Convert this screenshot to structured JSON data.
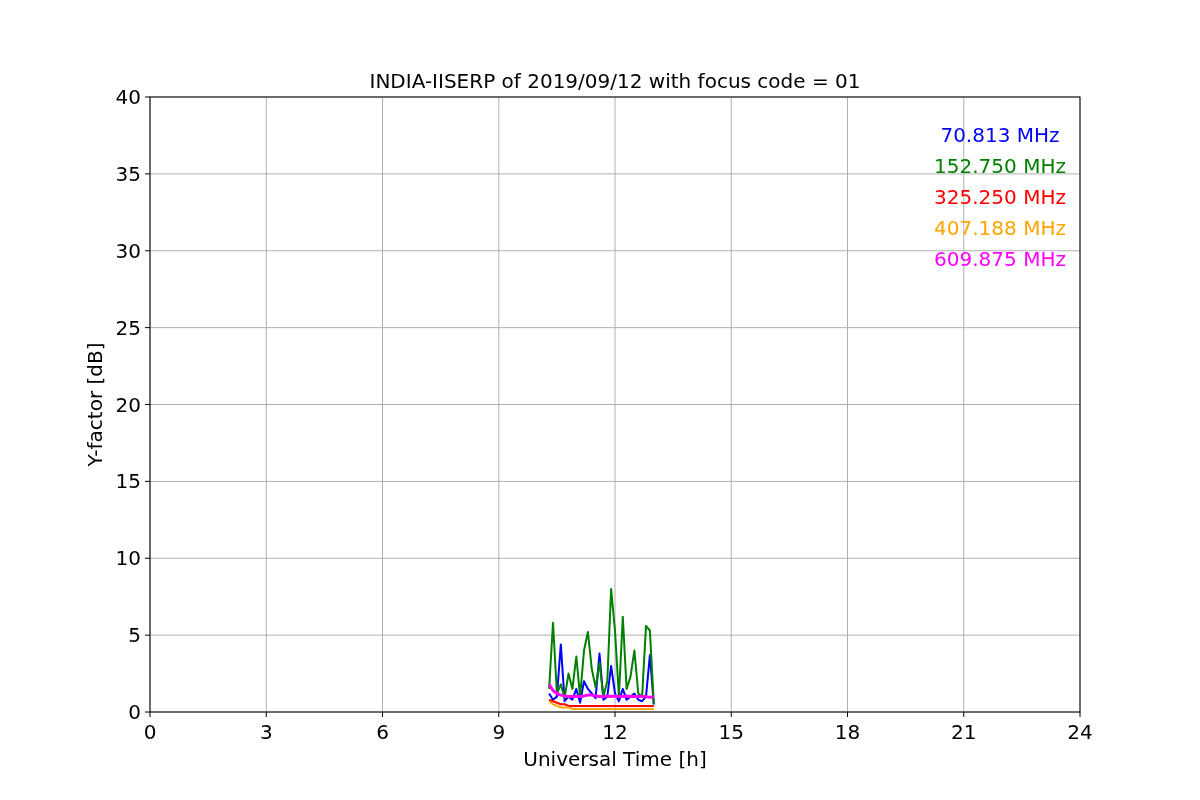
{
  "chart_data": {
    "type": "line",
    "title": "INDIA-IISERP of 2019/09/12 with focus code = 01",
    "xlabel": "Universal Time [h]",
    "ylabel": "Y-factor [dB]",
    "x": [
      10.3,
      10.4,
      10.5,
      10.6,
      10.7,
      10.8,
      10.9,
      11.0,
      11.1,
      11.2,
      11.3,
      11.4,
      11.5,
      11.6,
      11.7,
      11.8,
      11.9,
      12.0,
      12.1,
      12.2,
      12.3,
      12.4,
      12.5,
      12.6,
      12.7,
      12.8,
      12.9,
      13.0
    ],
    "series": [
      {
        "name": "70.813 MHz",
        "color": "#0000ff",
        "values": [
          1.2,
          0.8,
          1.0,
          4.4,
          0.7,
          1.0,
          0.8,
          1.5,
          0.6,
          2.0,
          1.5,
          1.2,
          0.9,
          3.8,
          0.8,
          1.0,
          3.0,
          1.2,
          0.7,
          1.5,
          0.8,
          1.0,
          1.2,
          0.8,
          0.7,
          1.0,
          3.7,
          0.5
        ]
      },
      {
        "name": "152.750 MHz",
        "color": "#008000",
        "values": [
          1.5,
          5.8,
          1.2,
          1.8,
          0.9,
          2.5,
          1.5,
          3.6,
          1.0,
          4.0,
          5.2,
          2.8,
          1.6,
          3.2,
          1.0,
          2.0,
          8.0,
          5.3,
          1.0,
          6.2,
          1.5,
          2.3,
          4.0,
          1.2,
          1.0,
          5.6,
          5.3,
          0.5
        ]
      },
      {
        "name": "325.250 MHz",
        "color": "#ff0000",
        "values": [
          0.8,
          0.7,
          0.6,
          0.5,
          0.5,
          0.4,
          0.4,
          0.4,
          0.4,
          0.4,
          0.4,
          0.4,
          0.4,
          0.4,
          0.4,
          0.4,
          0.4,
          0.4,
          0.4,
          0.4,
          0.4,
          0.4,
          0.4,
          0.4,
          0.4,
          0.4,
          0.4,
          0.4
        ]
      },
      {
        "name": "407.188 MHz",
        "color": "#ffa500",
        "values": [
          0.7,
          0.5,
          0.4,
          0.3,
          0.3,
          0.3,
          0.2,
          0.2,
          0.2,
          0.2,
          0.2,
          0.2,
          0.2,
          0.2,
          0.2,
          0.2,
          0.2,
          0.2,
          0.2,
          0.2,
          0.2,
          0.2,
          0.2,
          0.2,
          0.2,
          0.2,
          0.2,
          0.2
        ]
      },
      {
        "name": "609.875 MHz",
        "color": "#ff00ff",
        "values": [
          1.8,
          1.4,
          1.2,
          1.1,
          1.05,
          1.0,
          1.0,
          1.0,
          1.0,
          1.05,
          1.1,
          1.1,
          1.05,
          1.0,
          1.0,
          1.05,
          1.0,
          1.05,
          1.0,
          1.0,
          1.05,
          1.0,
          1.0,
          1.0,
          1.0,
          1.0,
          0.95,
          1.0
        ]
      }
    ],
    "grid": true,
    "xlim": [
      0,
      24
    ],
    "ylim": [
      0,
      40
    ],
    "xticks": [
      0,
      3,
      6,
      9,
      12,
      15,
      18,
      21,
      24
    ],
    "yticks": [
      0,
      5,
      10,
      15,
      20,
      25,
      30,
      35,
      40
    ]
  }
}
